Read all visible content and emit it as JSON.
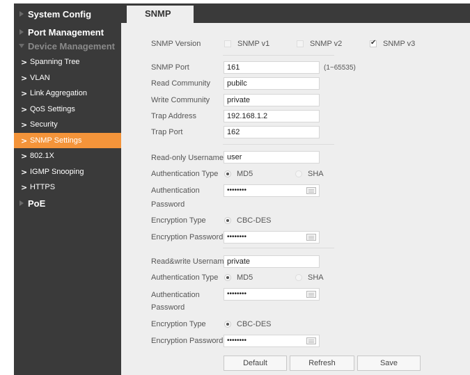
{
  "sidebar": {
    "top_items": [
      {
        "label": "System Config"
      },
      {
        "label": "Port Management"
      },
      {
        "label": "Device Management"
      },
      {
        "label": "PoE"
      }
    ],
    "sub_items": [
      {
        "label": "Spanning Tree"
      },
      {
        "label": "VLAN"
      },
      {
        "label": "Link Aggregation"
      },
      {
        "label": "QoS Settings"
      },
      {
        "label": "Security"
      },
      {
        "label": "SNMP Settings"
      },
      {
        "label": "802.1X"
      },
      {
        "label": "IGMP Snooping"
      },
      {
        "label": "HTTPS"
      }
    ],
    "active_color": "#f4943a"
  },
  "tab": {
    "label": "SNMP"
  },
  "form": {
    "snmp_version": {
      "label": "SNMP Version",
      "options": [
        {
          "label": "SNMP v1",
          "checked": false
        },
        {
          "label": "SNMP v2",
          "checked": false
        },
        {
          "label": "SNMP v3",
          "checked": true
        }
      ]
    },
    "snmp_port": {
      "label": "SNMP Port",
      "value": "161",
      "hint": "(1~65535)"
    },
    "read_community": {
      "label": "Read Community",
      "value": "pubilc"
    },
    "write_community": {
      "label": "Write Community",
      "value": "private"
    },
    "trap_address": {
      "label": "Trap Address",
      "value": "192.168.1.2"
    },
    "trap_port": {
      "label": "Trap Port",
      "value": "162"
    },
    "readonly": {
      "username_label": "Read-only Username",
      "username": "user",
      "auth_type_label": "Authentication Type",
      "auth_options": [
        "MD5",
        "SHA"
      ],
      "auth_selected": "MD5",
      "auth_pw_label_1": "Authentication",
      "auth_pw_label_2": "Password",
      "auth_pw": "••••••••",
      "enc_type_label": "Encryption Type",
      "enc_type": "CBC-DES",
      "enc_pw_label": "Encryption Password",
      "enc_pw": "••••••••"
    },
    "readwrite": {
      "username_label": "Read&write Username",
      "username": "private",
      "auth_type_label": "Authentication Type",
      "auth_options": [
        "MD5",
        "SHA"
      ],
      "auth_selected": "MD5",
      "auth_pw_label_1": "Authentication",
      "auth_pw_label_2": "Password",
      "auth_pw": "••••••••",
      "enc_type_label": "Encryption Type",
      "enc_type": "CBC-DES",
      "enc_pw_label": "Encryption Password",
      "enc_pw": "••••••••"
    }
  },
  "buttons": {
    "default": "Default",
    "refresh": "Refresh",
    "save": "Save"
  },
  "icons": {
    "keyboard": "keyboard-icon",
    "chevron": "chevron-right-icon",
    "triangle": "triangle-right-icon"
  }
}
